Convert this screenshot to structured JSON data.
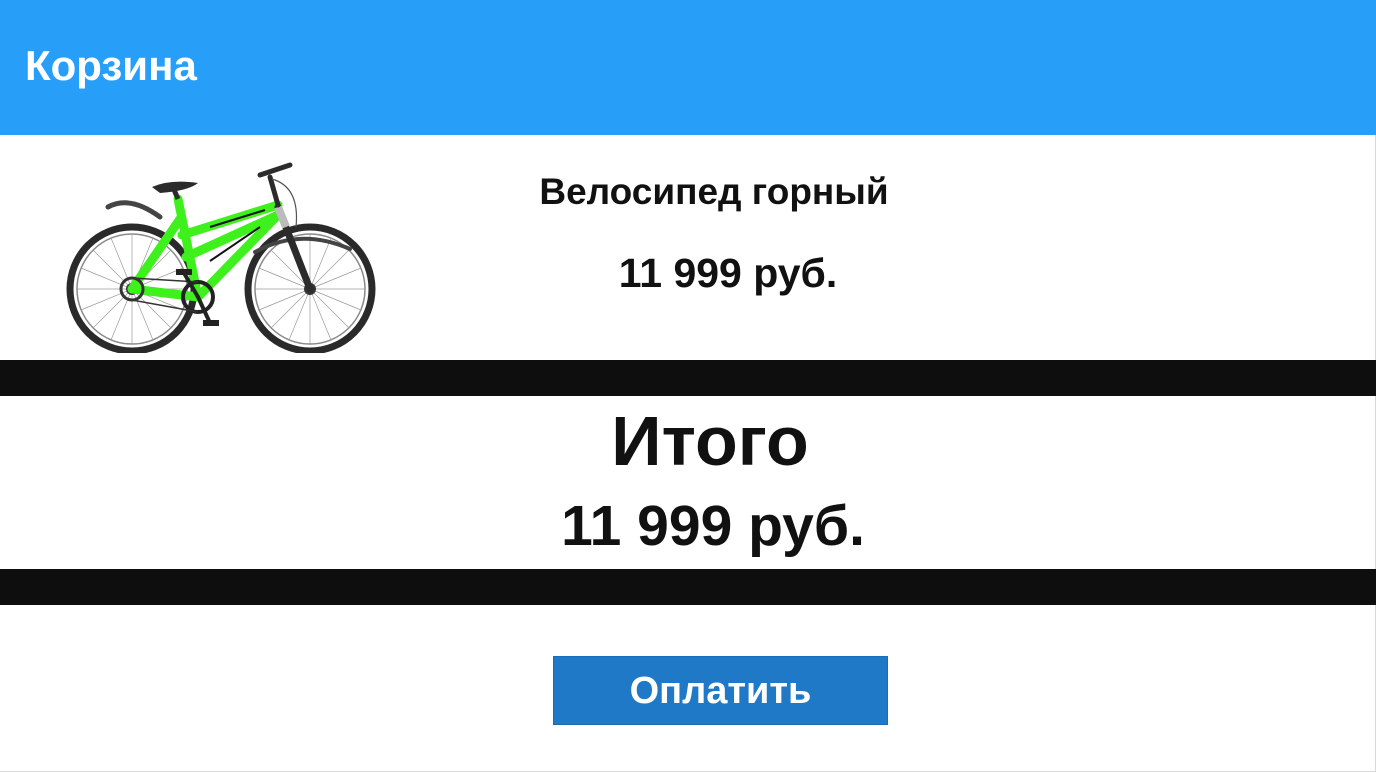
{
  "header": {
    "title": "Корзина",
    "color": "#279ff8"
  },
  "cart": {
    "items": [
      {
        "name": "Велосипед горный",
        "price": "11 999 руб.",
        "image_icon": "mountain-bike-image",
        "frame_color": "#3ef01c"
      }
    ]
  },
  "summary": {
    "total_label": "Итого",
    "total_value": "11 999 руб."
  },
  "actions": {
    "pay_label": "Оплатить",
    "pay_color": "#1f79c6"
  }
}
